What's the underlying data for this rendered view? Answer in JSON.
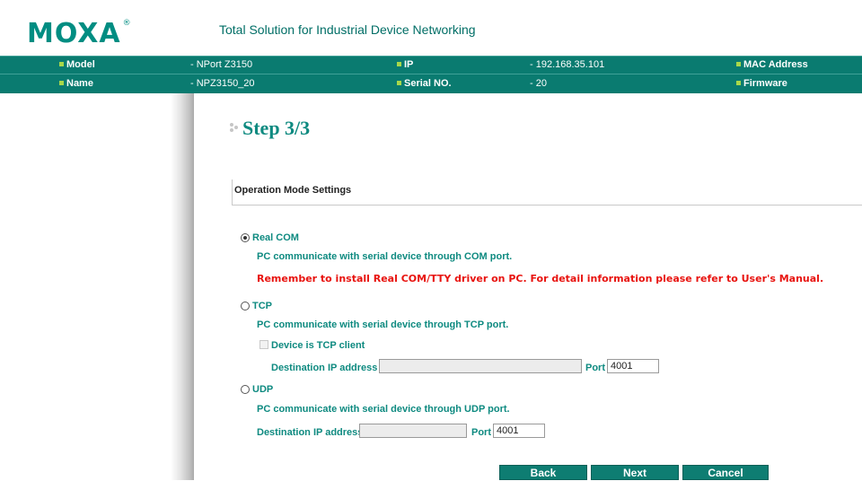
{
  "brand": {
    "logo_text": "MOXA",
    "logo_mark": "®",
    "tagline": "Total Solution for Industrial Device Networking"
  },
  "info": {
    "model_label": "Model",
    "model_value": "- NPort Z3150",
    "name_label": "Name",
    "name_value": "- NPZ3150_20",
    "ip_label": "IP",
    "ip_value": "- 192.168.35.101",
    "serial_label": "Serial NO.",
    "serial_value": "- 20",
    "mac_label": "MAC Address",
    "firmware_label": "Firmware"
  },
  "page": {
    "title": "Step 3/3",
    "section": "Operation Mode Settings"
  },
  "modes": {
    "real_com": {
      "label": "Real COM",
      "checked": true,
      "desc": "PC communicate with serial device through COM port.",
      "warning": "Remember to install Real COM/TTY driver on PC. For detail information please refer to User's Manual."
    },
    "tcp": {
      "label": "TCP",
      "checked": false,
      "desc": "PC communicate with serial device through TCP port.",
      "client_label": "Device is TCP client",
      "dest_label": "Destination IP address",
      "dest_value": "",
      "port_label": "Port",
      "port_value": "4001"
    },
    "udp": {
      "label": "UDP",
      "checked": false,
      "desc": "PC communicate with serial device through UDP port.",
      "dest_label": "Destination IP address",
      "dest_value": "",
      "port_label": "Port",
      "port_value": "4001"
    }
  },
  "buttons": {
    "back": "Back",
    "next": "Next",
    "cancel": "Cancel"
  },
  "colors": {
    "brand_teal": "#0e8a80",
    "bar_teal": "#0a7b70",
    "warning_red": "#e8130f",
    "bullet_green": "#a8d84a"
  }
}
